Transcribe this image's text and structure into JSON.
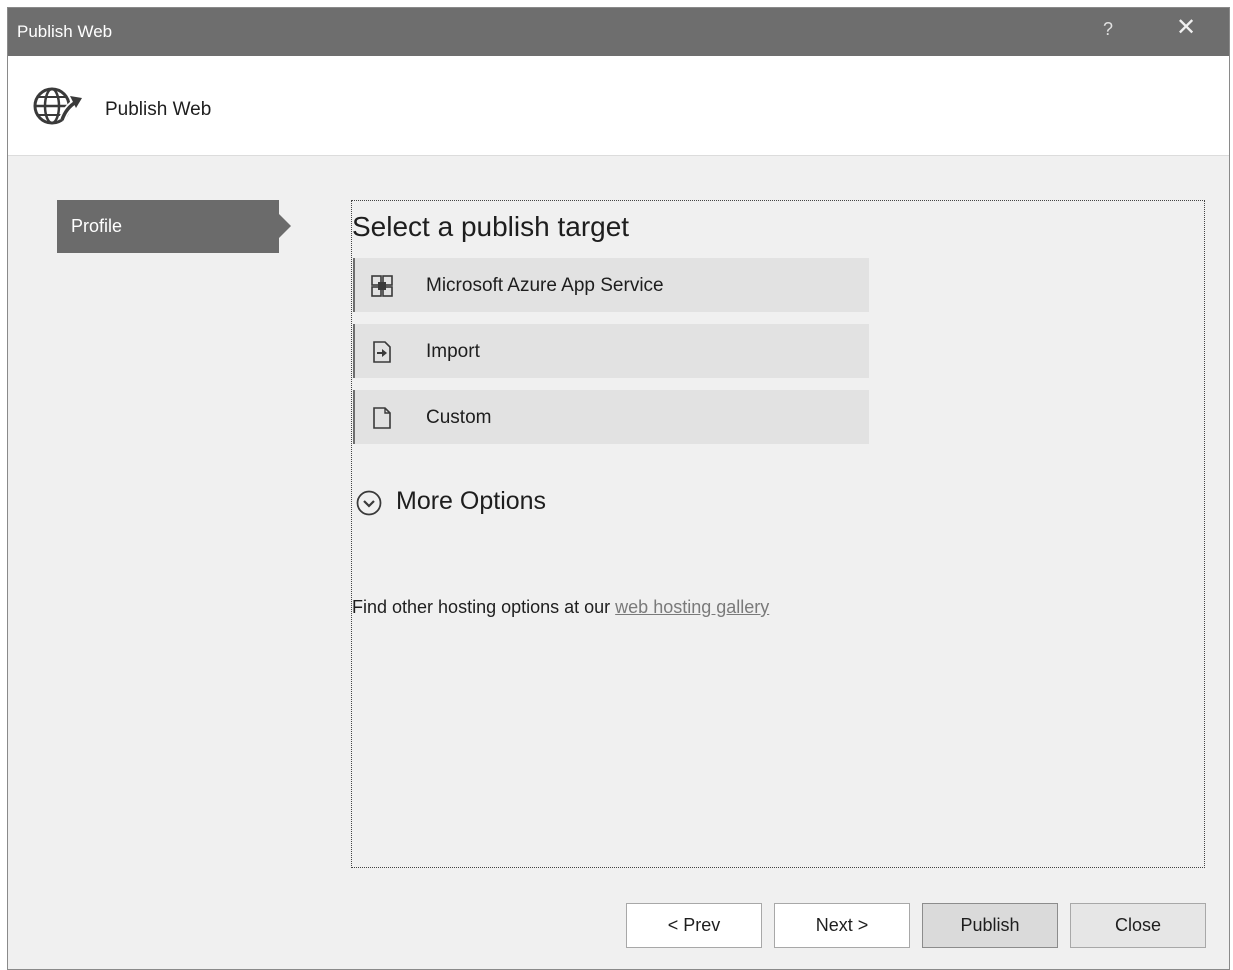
{
  "window": {
    "title": "Publish Web",
    "help_glyph": "?",
    "close_glyph": "✕"
  },
  "header": {
    "title": "Publish Web",
    "icon": "globe-publish-icon"
  },
  "steps": [
    {
      "label": "Profile",
      "active": true
    }
  ],
  "main": {
    "heading": "Select a publish target",
    "targets": [
      {
        "label": "Microsoft Azure App Service",
        "icon": "azure-app-service-icon"
      },
      {
        "label": "Import",
        "icon": "import-icon"
      },
      {
        "label": "Custom",
        "icon": "document-icon"
      }
    ],
    "more_options": {
      "label": "More Options",
      "icon": "chevron-down-circle-icon"
    },
    "find_text": "Find other hosting options at our ",
    "find_link": "web hosting gallery"
  },
  "footer": {
    "buttons": {
      "prev": "< Prev",
      "next": "Next >",
      "publish": "Publish",
      "close": "Close"
    }
  },
  "colors": {
    "titlebar": "#6e6e6e",
    "active_step": "#6b6b6b",
    "target_bg": "#e2e2e2",
    "window_bg": "#f0f0f0"
  }
}
